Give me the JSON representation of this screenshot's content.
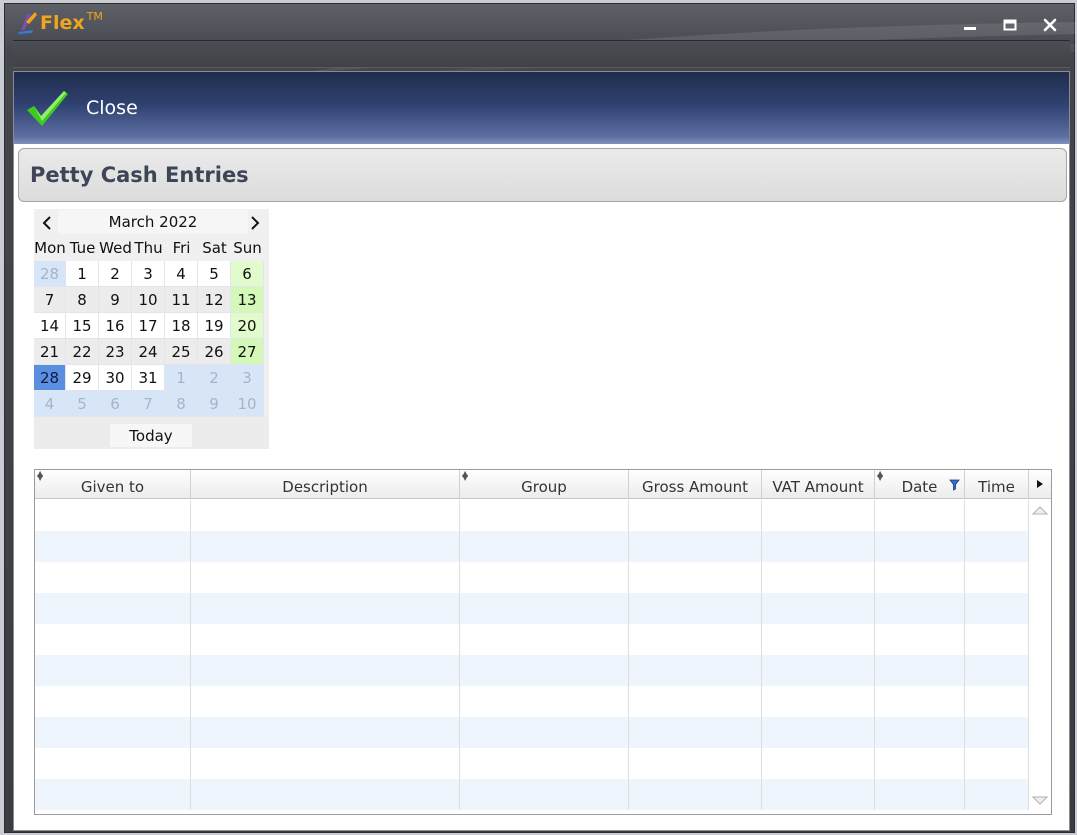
{
  "app": {
    "name": "Flex",
    "trademark": "TM"
  },
  "toolbar": {
    "close_label": "Close"
  },
  "page": {
    "title": "Petty Cash Entries"
  },
  "calendar": {
    "month_label": "March 2022",
    "weekdays": [
      "Mon",
      "Tue",
      "Wed",
      "Thu",
      "Fri",
      "Sat",
      "Sun"
    ],
    "selected_day": "28",
    "today_label": "Today",
    "weeks": [
      [
        "28",
        "1",
        "2",
        "3",
        "4",
        "5",
        "6"
      ],
      [
        "7",
        "8",
        "9",
        "10",
        "11",
        "12",
        "13"
      ],
      [
        "14",
        "15",
        "16",
        "17",
        "18",
        "19",
        "20"
      ],
      [
        "21",
        "22",
        "23",
        "24",
        "25",
        "26",
        "27"
      ],
      [
        "28",
        "29",
        "30",
        "31",
        "1",
        "2",
        "3"
      ],
      [
        "4",
        "5",
        "6",
        "7",
        "8",
        "9",
        "10"
      ]
    ]
  },
  "grid": {
    "columns": [
      {
        "label": "Given to",
        "sortable": true,
        "filtered": false
      },
      {
        "label": "Description",
        "sortable": false,
        "filtered": false
      },
      {
        "label": "Group",
        "sortable": true,
        "filtered": false
      },
      {
        "label": "Gross Amount",
        "sortable": false,
        "filtered": false
      },
      {
        "label": "VAT Amount",
        "sortable": false,
        "filtered": false
      },
      {
        "label": "Date",
        "sortable": true,
        "filtered": true
      },
      {
        "label": "Time",
        "sortable": false,
        "filtered": false
      }
    ],
    "rows": []
  }
}
